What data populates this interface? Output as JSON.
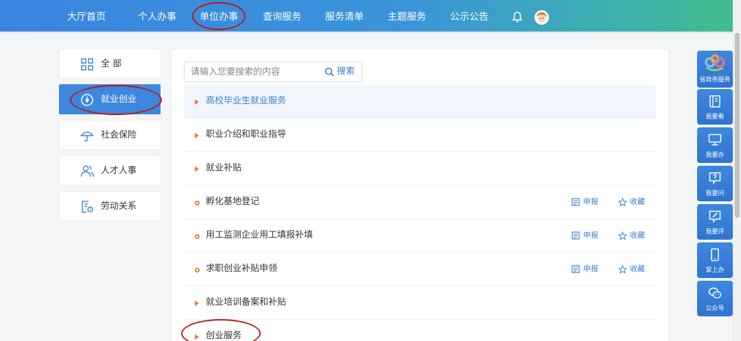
{
  "nav": {
    "items": [
      {
        "label": "大厅首页"
      },
      {
        "label": "个人办事"
      },
      {
        "label": "单位办事"
      },
      {
        "label": "查询服务"
      },
      {
        "label": "服务清单"
      },
      {
        "label": "主题服务"
      },
      {
        "label": "公示公告"
      }
    ],
    "active": "单位办事"
  },
  "categories": [
    {
      "label": "全 部",
      "icon": "grid-icon"
    },
    {
      "label": "就业创业",
      "icon": "employment-icon",
      "active": true
    },
    {
      "label": "社会保险",
      "icon": "umbrella-icon"
    },
    {
      "label": "人才人事",
      "icon": "people-icon"
    },
    {
      "label": "劳动关系",
      "icon": "document-gear-icon"
    }
  ],
  "search": {
    "placeholder": "请输入您要搜索的内容",
    "button_label": "搜索"
  },
  "services": [
    {
      "label": "高校毕业生就业服务",
      "type": "group",
      "highlighted": true
    },
    {
      "label": "职业介绍和职业指导",
      "type": "group"
    },
    {
      "label": "就业补贴",
      "type": "group"
    },
    {
      "label": "孵化基地登记",
      "type": "item",
      "apply_label": "申报",
      "fav_label": "收藏"
    },
    {
      "label": "用工监测企业用工填报补填",
      "type": "item",
      "apply_label": "申报",
      "fav_label": "收藏"
    },
    {
      "label": "求职创业补贴申领",
      "type": "item",
      "apply_label": "申报",
      "fav_label": "收藏"
    },
    {
      "label": "就业培训备案和补贴",
      "type": "group"
    },
    {
      "label": "创业服务",
      "type": "group"
    }
  ],
  "toolbar": [
    {
      "label": "省政务服务",
      "icon": "gov-logo-icon"
    },
    {
      "label": "我要看",
      "icon": "book-icon"
    },
    {
      "label": "我要办",
      "icon": "monitor-icon"
    },
    {
      "label": "我要问",
      "icon": "question-icon"
    },
    {
      "label": "我要评",
      "icon": "edit-icon"
    },
    {
      "label": "掌上办",
      "icon": "mobile-icon"
    },
    {
      "label": "公众号",
      "icon": "wechat-icon"
    }
  ],
  "colors": {
    "nav_start": "#3a84df",
    "nav_end": "#42bd8c",
    "accent": "#3d87de",
    "marker": "#ef7a3e",
    "annotation": "#b71c1c"
  }
}
